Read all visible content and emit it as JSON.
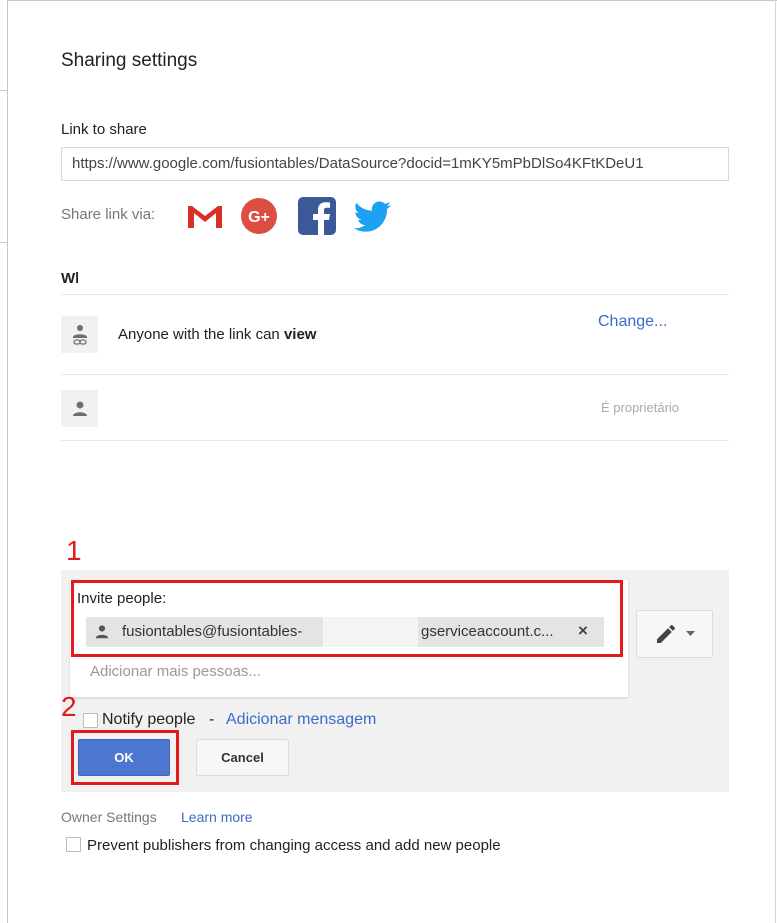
{
  "dialog": {
    "title": "Sharing settings",
    "link_label": "Link to share",
    "link_value": "https://www.google.com/fusiontables/DataSource?docid=1mKY5mPbDlSo4KFtKDeU1",
    "share_via_label": "Share link via:",
    "share_icons": [
      "gmail-icon",
      "google-plus-icon",
      "facebook-icon",
      "twitter-icon"
    ],
    "who_label": "Wh"
  },
  "access": {
    "link_access_prefix": "Anyone with the link can ",
    "link_access_level": "view",
    "change_link": "Change...",
    "owner_role": "É proprietário"
  },
  "callouts": {
    "first": "1",
    "second": "2"
  },
  "invite": {
    "label": "Invite people:",
    "chip_text_start": "fusiontables@fusiontables-",
    "chip_text_end": "gserviceaccount.c...",
    "chip_remove": "×",
    "add_more_placeholder": "Adicionar mais pessoas...",
    "notify_label": "Notify people",
    "notify_separator": "-",
    "add_message_link": "Adicionar mensagem",
    "ok_label": "OK",
    "cancel_label": "Cancel"
  },
  "owner_settings": {
    "label": "Owner Settings",
    "learn_more": "Learn more",
    "prevent_label": "Prevent publishers from changing access and add new people"
  },
  "colors": {
    "accent": "#4d76d0",
    "link": "#3b6bc9",
    "annotation": "#e01b1b",
    "gmail": "#d93025",
    "google_plus": "#dc4e41",
    "facebook": "#3b5998",
    "twitter": "#1da1f2"
  }
}
